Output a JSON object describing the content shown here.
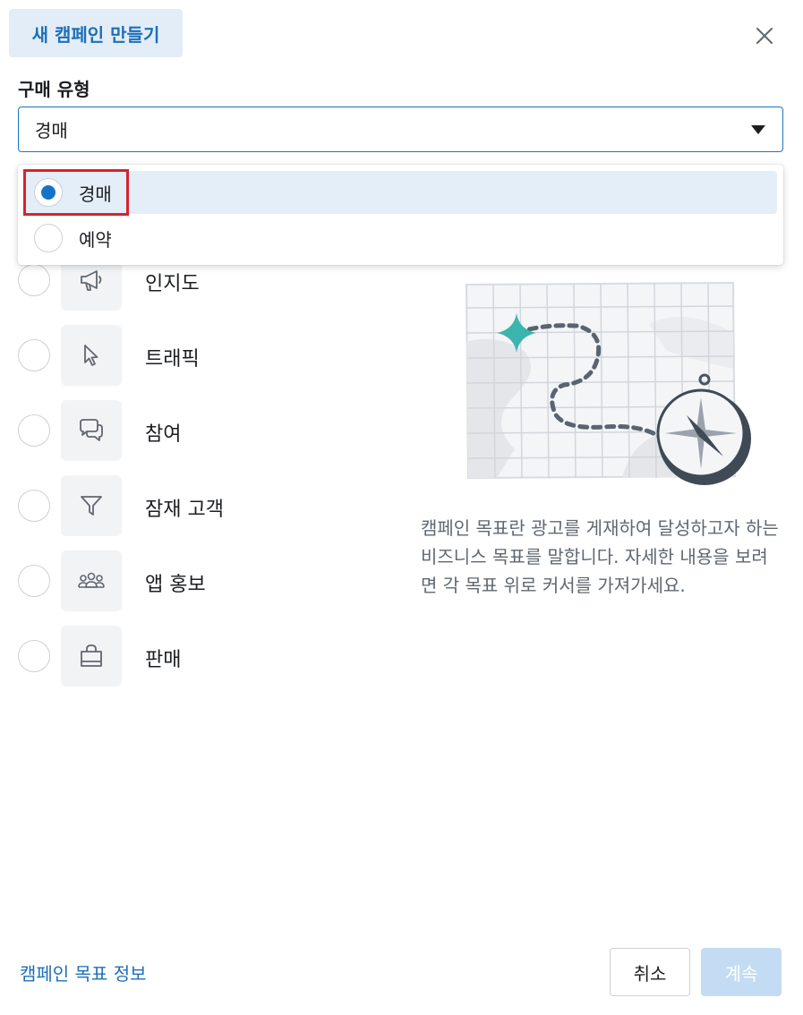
{
  "header": {
    "title": "새 캠페인 만들기"
  },
  "buying_type": {
    "label": "구매 유형",
    "selected": "경매",
    "options": [
      {
        "label": "경매",
        "selected": true
      },
      {
        "label": "예약",
        "selected": false
      }
    ]
  },
  "objectives": [
    {
      "label": "인지도",
      "icon": "megaphone-icon"
    },
    {
      "label": "트래픽",
      "icon": "cursor-icon"
    },
    {
      "label": "참여",
      "icon": "chat-bubbles-icon"
    },
    {
      "label": "잠재 고객",
      "icon": "funnel-icon"
    },
    {
      "label": "앱 홍보",
      "icon": "people-icon"
    },
    {
      "label": "판매",
      "icon": "shopping-bag-icon"
    }
  ],
  "description": "캠페인 목표란 광고를 게재하여 달성하고자 하는 비즈니스 목표를 말합니다. 자세한 내용을 보려면 각 목표 위로 커서를 가져가세요.",
  "footer": {
    "info_link": "캠페인 목표 정보",
    "cancel": "취소",
    "continue": "계속"
  },
  "colors": {
    "accent": "#1d6fb8",
    "highlight": "#d6242d",
    "disabled_button": "#c3dcf3"
  }
}
